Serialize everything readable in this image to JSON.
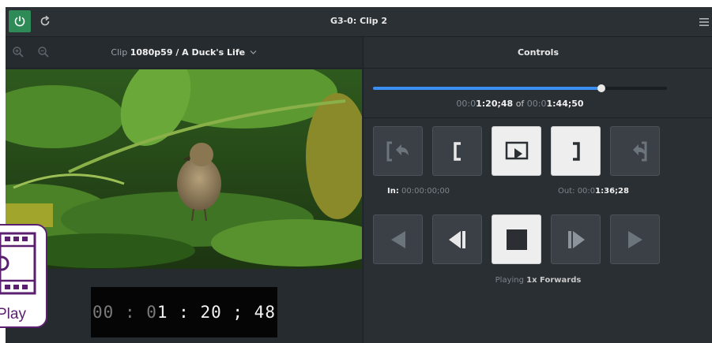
{
  "window": {
    "title": "G3-0: Clip 2"
  },
  "colors": {
    "power": "#2e8b57",
    "progress": "#3b8ff0",
    "badge": "#5a1f6e"
  },
  "toolbar": {
    "clip_prefix": "Clip",
    "clip_name": "1080p59 / A Duck's Life",
    "dropdown_icon": "chevron-down-icon"
  },
  "player": {
    "timecode_dim": "00 : 0",
    "timecode_bright": "1 : 20 ; 48"
  },
  "controls": {
    "title": "Controls",
    "progress": {
      "fraction": 0.778,
      "current_dim": "00:0",
      "current_bright": "1:20;48",
      "of_label": "of",
      "total_dim": "00:0",
      "total_bright": "1:44;50"
    },
    "in_label": "In:",
    "in_value": "00:00:00;00",
    "out_label": "Out:",
    "out_dim": "00:0",
    "out_bright": "1:36;28",
    "status_prefix": "Playing",
    "status_value": "1x Forwards"
  },
  "badge": {
    "label": "Play"
  }
}
